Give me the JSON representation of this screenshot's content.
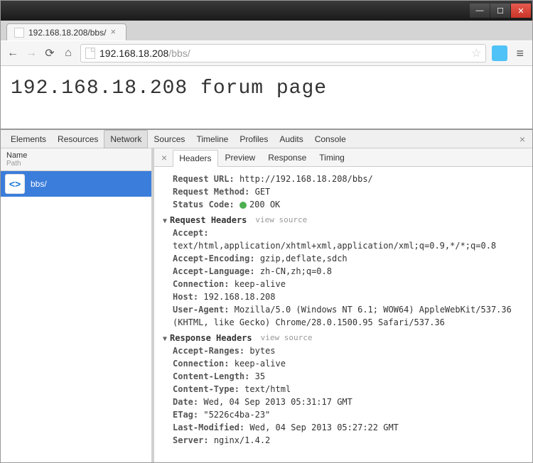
{
  "window": {
    "minimize": "—",
    "maximize": "☐",
    "close": "✕"
  },
  "tab": {
    "title": "192.168.18.208/bbs/",
    "close": "×"
  },
  "toolbar": {
    "back": "←",
    "forward": "→",
    "reload": "⟳",
    "home": "⌂",
    "url_host": "192.168.18.208",
    "url_path": "/bbs/",
    "star": "☆",
    "menu": "≡"
  },
  "page": {
    "heading": "192.168.18.208 forum page"
  },
  "devtools": {
    "tabs": {
      "elements": "Elements",
      "resources": "Resources",
      "network": "Network",
      "sources": "Sources",
      "timeline": "Timeline",
      "profiles": "Profiles",
      "audits": "Audits",
      "console": "Console"
    },
    "close": "×",
    "network": {
      "list_header_name": "Name",
      "list_header_path": "Path",
      "rows": [
        {
          "name": "bbs/",
          "icon": "<>"
        }
      ],
      "detail_tabs": {
        "headers": "Headers",
        "preview": "Preview",
        "response": "Response",
        "timing": "Timing"
      },
      "detail_close": "×",
      "general": {
        "request_url_label": "Request URL:",
        "request_url": "http://192.168.18.208/bbs/",
        "request_method_label": "Request Method:",
        "request_method": "GET",
        "status_code_label": "Status Code:",
        "status_code": "200 OK"
      },
      "request_headers_label": "Request Headers",
      "view_source": "view source",
      "request_headers": {
        "accept_label": "Accept:",
        "accept": "text/html,application/xhtml+xml,application/xml;q=0.9,*/*;q=0.8",
        "accept_encoding_label": "Accept-Encoding:",
        "accept_encoding": "gzip,deflate,sdch",
        "accept_language_label": "Accept-Language:",
        "accept_language": "zh-CN,zh;q=0.8",
        "connection_label": "Connection:",
        "connection": "keep-alive",
        "host_label": "Host:",
        "host": "192.168.18.208",
        "user_agent_label": "User-Agent:",
        "user_agent": "Mozilla/5.0 (Windows NT 6.1; WOW64) AppleWebKit/537.36 (KHTML, like Gecko) Chrome/28.0.1500.95 Safari/537.36"
      },
      "response_headers_label": "Response Headers",
      "response_headers": {
        "accept_ranges_label": "Accept-Ranges:",
        "accept_ranges": "bytes",
        "connection_label": "Connection:",
        "connection": "keep-alive",
        "content_length_label": "Content-Length:",
        "content_length": "35",
        "content_type_label": "Content-Type:",
        "content_type": "text/html",
        "date_label": "Date:",
        "date": "Wed, 04 Sep 2013 05:31:17 GMT",
        "etag_label": "ETag:",
        "etag": "\"5226c4ba-23\"",
        "last_modified_label": "Last-Modified:",
        "last_modified": "Wed, 04 Sep 2013 05:27:22 GMT",
        "server_label": "Server:",
        "server": "nginx/1.4.2"
      }
    }
  }
}
